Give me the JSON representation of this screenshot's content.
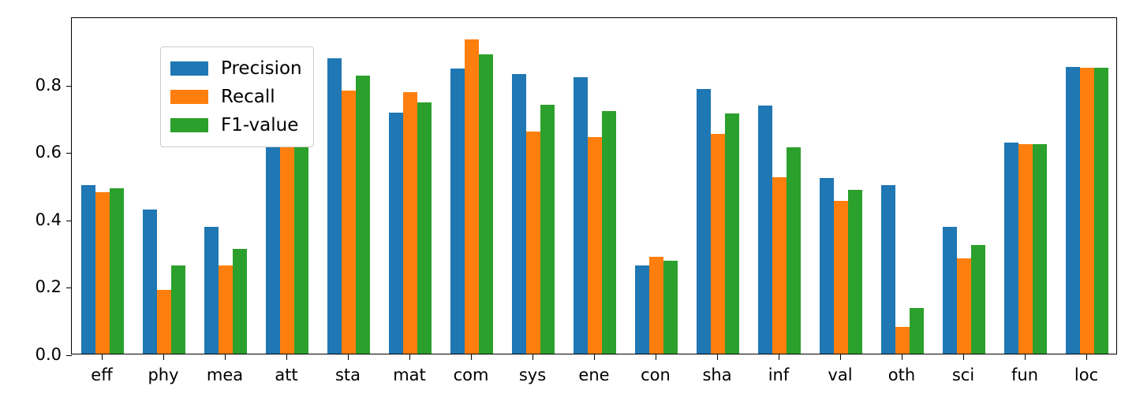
{
  "chart_data": {
    "type": "bar",
    "title": "",
    "subtitle": "",
    "xlabel": "",
    "ylabel": "",
    "xlim_categories": 17,
    "ylim": [
      0.0,
      1.0
    ],
    "yticks": [
      "0.0",
      "0.2",
      "0.4",
      "0.6",
      "0.8"
    ],
    "ytick_values": [
      0.0,
      0.2,
      0.4,
      0.6,
      0.8
    ],
    "grid": false,
    "legend_position": "upper left",
    "categories": [
      "eff",
      "phy",
      "mea",
      "att",
      "sta",
      "mat",
      "com",
      "sys",
      "ene",
      "con",
      "sha",
      "inf",
      "val",
      "oth",
      "sci",
      "fun",
      "loc"
    ],
    "series": [
      {
        "name": "Precision",
        "color": "#1f77b4",
        "values": [
          0.5,
          0.427,
          0.377,
          0.82,
          0.877,
          0.715,
          0.845,
          0.83,
          0.82,
          0.262,
          0.785,
          0.735,
          0.52,
          0.5,
          0.377,
          0.627,
          0.85
        ]
      },
      {
        "name": "Recall",
        "color": "#ff7f0e",
        "values": [
          0.48,
          0.19,
          0.262,
          0.763,
          0.78,
          0.775,
          0.932,
          0.66,
          0.642,
          0.287,
          0.652,
          0.523,
          0.453,
          0.08,
          0.283,
          0.622,
          0.847
        ]
      },
      {
        "name": "F1-value",
        "color": "#2ca02c",
        "values": [
          0.49,
          0.262,
          0.31,
          0.79,
          0.825,
          0.745,
          0.887,
          0.738,
          0.72,
          0.275,
          0.712,
          0.612,
          0.485,
          0.135,
          0.323,
          0.622,
          0.847
        ]
      }
    ]
  },
  "legend": {
    "entries": [
      {
        "label": "Precision",
        "color": "#1f77b4"
      },
      {
        "label": "Recall",
        "color": "#ff7f0e"
      },
      {
        "label": "F1-value",
        "color": "#2ca02c"
      }
    ]
  }
}
